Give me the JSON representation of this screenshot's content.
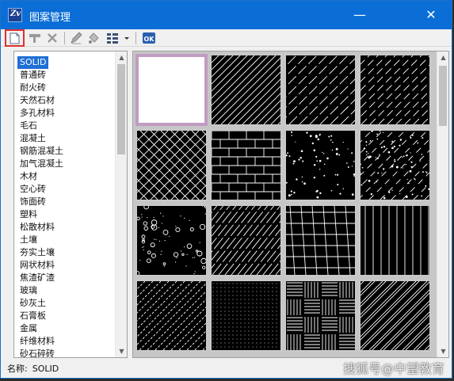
{
  "window": {
    "title": "图案管理",
    "close_glyph": "✕",
    "minimize_glyph": "—"
  },
  "toolbar": {
    "icons": [
      "new-pattern-icon",
      "edit-pattern-icon",
      "delete-icon",
      "pencil-icon",
      "paint-icon",
      "view-grid-icon",
      "dropdown-arrow-icon",
      "ok-icon"
    ],
    "ok_label": "OK"
  },
  "patterns": {
    "items": [
      "SOLID",
      "普通砖",
      "耐火砖",
      "天然石材",
      "多孔材料",
      "毛石",
      "混凝土",
      "钢筋混凝土",
      "加气混凝土",
      "木材",
      "空心砖",
      "饰面砖",
      "塑料",
      "松散材料",
      "土壤",
      "夯实土壤",
      "网状材料",
      "焦渣矿渣",
      "玻璃",
      "砂灰土",
      "石膏板",
      "金属",
      "纤维材料",
      "砂石碎砖"
    ],
    "selected_index": 0
  },
  "status": {
    "label": "名称:",
    "value": "SOLID"
  },
  "watermark": "搜狐号@中望教育",
  "colors": {
    "titlebar": "#0a6ed6",
    "selection": "#1f6fd6",
    "highlight_border": "#e0302c",
    "solid_border": "#c09cc2"
  }
}
